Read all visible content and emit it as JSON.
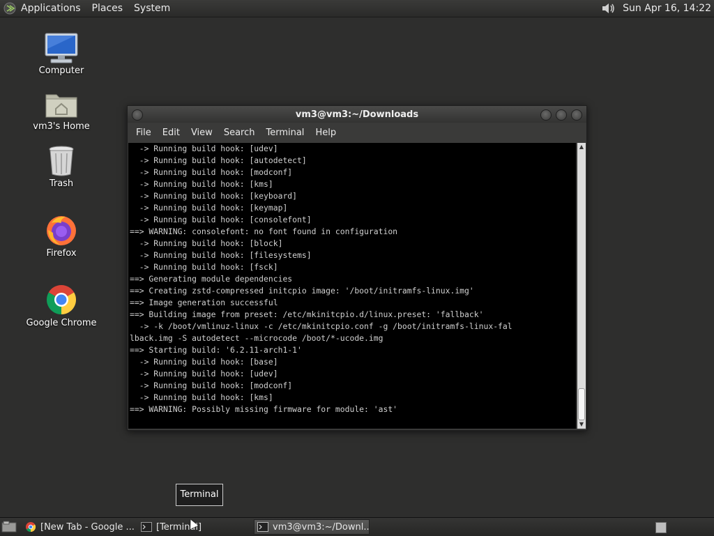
{
  "top_panel": {
    "menus": [
      "Applications",
      "Places",
      "System"
    ],
    "clock": "Sun Apr 16, 14:22",
    "volume_icon": "speaker-icon"
  },
  "desktop": {
    "icons": [
      {
        "label": "Computer",
        "icon": "computer-icon"
      },
      {
        "label": "vm3's Home",
        "icon": "home-folder-icon"
      },
      {
        "label": "Trash",
        "icon": "trash-icon"
      },
      {
        "label": "Firefox",
        "icon": "firefox-icon"
      },
      {
        "label": "Google Chrome",
        "icon": "chrome-icon"
      }
    ]
  },
  "terminal_window": {
    "title": "vm3@vm3:~/Downloads",
    "menu": [
      "File",
      "Edit",
      "View",
      "Search",
      "Terminal",
      "Help"
    ],
    "lines": [
      "  -> Running build hook: [udev]",
      "  -> Running build hook: [autodetect]",
      "  -> Running build hook: [modconf]",
      "  -> Running build hook: [kms]",
      "  -> Running build hook: [keyboard]",
      "  -> Running build hook: [keymap]",
      "  -> Running build hook: [consolefont]",
      "==> WARNING: consolefont: no font found in configuration",
      "  -> Running build hook: [block]",
      "  -> Running build hook: [filesystems]",
      "  -> Running build hook: [fsck]",
      "==> Generating module dependencies",
      "==> Creating zstd-compressed initcpio image: '/boot/initramfs-linux.img'",
      "==> Image generation successful",
      "==> Building image from preset: /etc/mkinitcpio.d/linux.preset: 'fallback'",
      "  -> -k /boot/vmlinuz-linux -c /etc/mkinitcpio.conf -g /boot/initramfs-linux-fal",
      "lback.img -S autodetect --microcode /boot/*-ucode.img",
      "==> Starting build: '6.2.11-arch1-1'",
      "  -> Running build hook: [base]",
      "  -> Running build hook: [udev]",
      "  -> Running build hook: [modconf]",
      "  -> Running build hook: [kms]",
      "==> WARNING: Possibly missing firmware for module: 'ast'"
    ]
  },
  "tooltip": "Terminal",
  "bottom_panel": {
    "tasks": [
      {
        "label": "[New Tab - Google ...",
        "icon": "chrome-icon",
        "active": false
      },
      {
        "label": "[Terminal]",
        "icon": "terminal-icon",
        "active": false
      },
      {
        "label": "vm3@vm3:~/Downl...",
        "icon": "terminal-icon",
        "active": true
      }
    ],
    "show_desktop_icon": "show-desktop-icon",
    "workspace_icon": "workspace-switcher-icon"
  }
}
